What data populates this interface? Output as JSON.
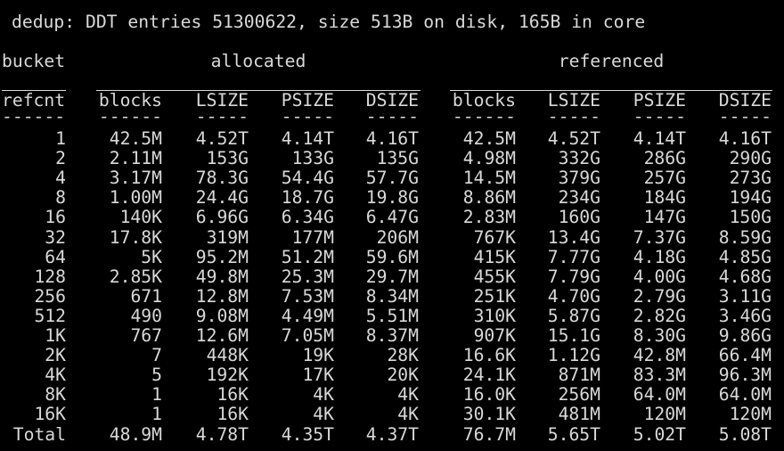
{
  "header_line": "dedup: DDT entries 51300622, size 513B on disk, 165B in core",
  "group_header": {
    "bucket": "bucket",
    "allocated": "allocated",
    "referenced": "referenced"
  },
  "column_headers": [
    "refcnt",
    "blocks",
    "LSIZE",
    "PSIZE",
    "DSIZE",
    "blocks",
    "LSIZE",
    "PSIZE",
    "DSIZE"
  ],
  "separators": [
    "------",
    "------",
    "-----",
    "-----",
    "-----",
    "------",
    "-----",
    "-----",
    "-----"
  ],
  "rows": [
    [
      "1",
      "42.5M",
      "4.52T",
      "4.14T",
      "4.16T",
      "42.5M",
      "4.52T",
      "4.14T",
      "4.16T"
    ],
    [
      "2",
      "2.11M",
      "153G",
      "133G",
      "135G",
      "4.98M",
      "332G",
      "286G",
      "290G"
    ],
    [
      "4",
      "3.17M",
      "78.3G",
      "54.4G",
      "57.7G",
      "14.5M",
      "379G",
      "257G",
      "273G"
    ],
    [
      "8",
      "1.00M",
      "24.4G",
      "18.7G",
      "19.8G",
      "8.86M",
      "234G",
      "184G",
      "194G"
    ],
    [
      "16",
      "140K",
      "6.96G",
      "6.34G",
      "6.47G",
      "2.83M",
      "160G",
      "147G",
      "150G"
    ],
    [
      "32",
      "17.8K",
      "319M",
      "177M",
      "206M",
      "767K",
      "13.4G",
      "7.37G",
      "8.59G"
    ],
    [
      "64",
      "5K",
      "95.2M",
      "51.2M",
      "59.6M",
      "415K",
      "7.77G",
      "4.18G",
      "4.85G"
    ],
    [
      "128",
      "2.85K",
      "49.8M",
      "25.3M",
      "29.7M",
      "455K",
      "7.79G",
      "4.00G",
      "4.68G"
    ],
    [
      "256",
      "671",
      "12.8M",
      "7.53M",
      "8.34M",
      "251K",
      "4.70G",
      "2.79G",
      "3.11G"
    ],
    [
      "512",
      "490",
      "9.08M",
      "4.49M",
      "5.51M",
      "310K",
      "5.87G",
      "2.82G",
      "3.46G"
    ],
    [
      "1K",
      "767",
      "12.6M",
      "7.05M",
      "8.37M",
      "907K",
      "15.1G",
      "8.30G",
      "9.86G"
    ],
    [
      "2K",
      "7",
      "448K",
      "19K",
      "28K",
      "16.6K",
      "1.12G",
      "42.8M",
      "66.4M"
    ],
    [
      "4K",
      "5",
      "192K",
      "17K",
      "20K",
      "24.1K",
      "871M",
      "83.3M",
      "96.3M"
    ],
    [
      "8K",
      "1",
      "16K",
      "4K",
      "4K",
      "16.0K",
      "256M",
      "64.0M",
      "64.0M"
    ],
    [
      "16K",
      "1",
      "16K",
      "4K",
      "4K",
      "30.1K",
      "481M",
      "120M",
      "120M"
    ]
  ],
  "total_row": [
    "Total",
    "48.9M",
    "4.78T",
    "4.35T",
    "4.37T",
    "76.7M",
    "5.65T",
    "5.02T",
    "5.08T"
  ],
  "colors": {
    "background": "#000000",
    "foreground": "#d9d9d9"
  }
}
